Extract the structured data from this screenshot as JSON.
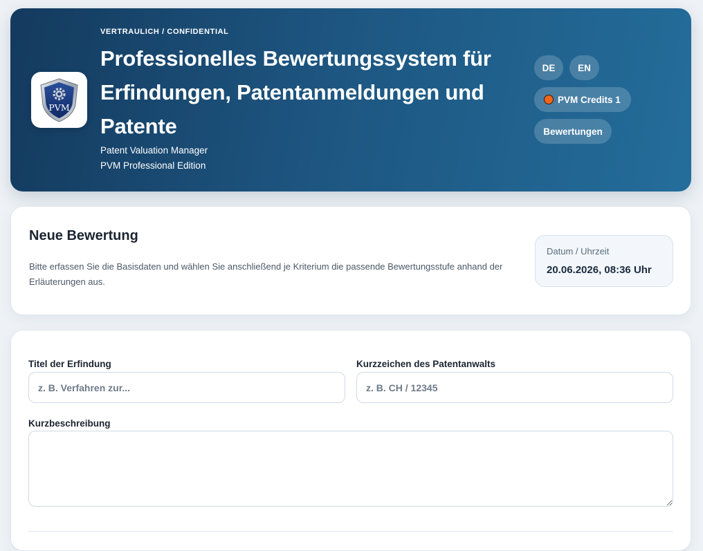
{
  "header": {
    "eyebrow": "VERTRAULICH / CONFIDENTIAL",
    "title": "Professionelles Bewertungssystem für Erfindungen, Patentanmeldungen und Patente",
    "subtitle_1": "Patent Valuation Manager",
    "subtitle_2": "PVM Professional Edition",
    "logo_text": "PVM",
    "lang_de": "DE",
    "lang_en": "EN",
    "credits_label": "PVM Credits 1",
    "evaluations_button": "Bewertungen",
    "colors": {
      "gradient_start": "#143a5e",
      "gradient_end": "#246d9b",
      "credit_dot": "#f0651a"
    }
  },
  "intro_card": {
    "title": "Neue Bewertung",
    "description": "Bitte erfassen Sie die Basisdaten und wählen Sie anschließend je Kriterium die passende Bewertungsstufe anhand der Erläuterungen aus.",
    "date_label": "Datum / Uhrzeit",
    "date_value": "20.06.2026, 08:36 Uhr"
  },
  "form": {
    "invention_title_label": "Titel der Erfindung",
    "invention_title_placeholder": "z. B. Verfahren zur...",
    "invention_title_value": "",
    "attorney_ref_label": "Kurzzeichen des Patentanwalts",
    "attorney_ref_placeholder": "z. B. CH / 12345",
    "attorney_ref_value": "",
    "short_description_label": "Kurzbeschreibung",
    "short_description_value": ""
  }
}
